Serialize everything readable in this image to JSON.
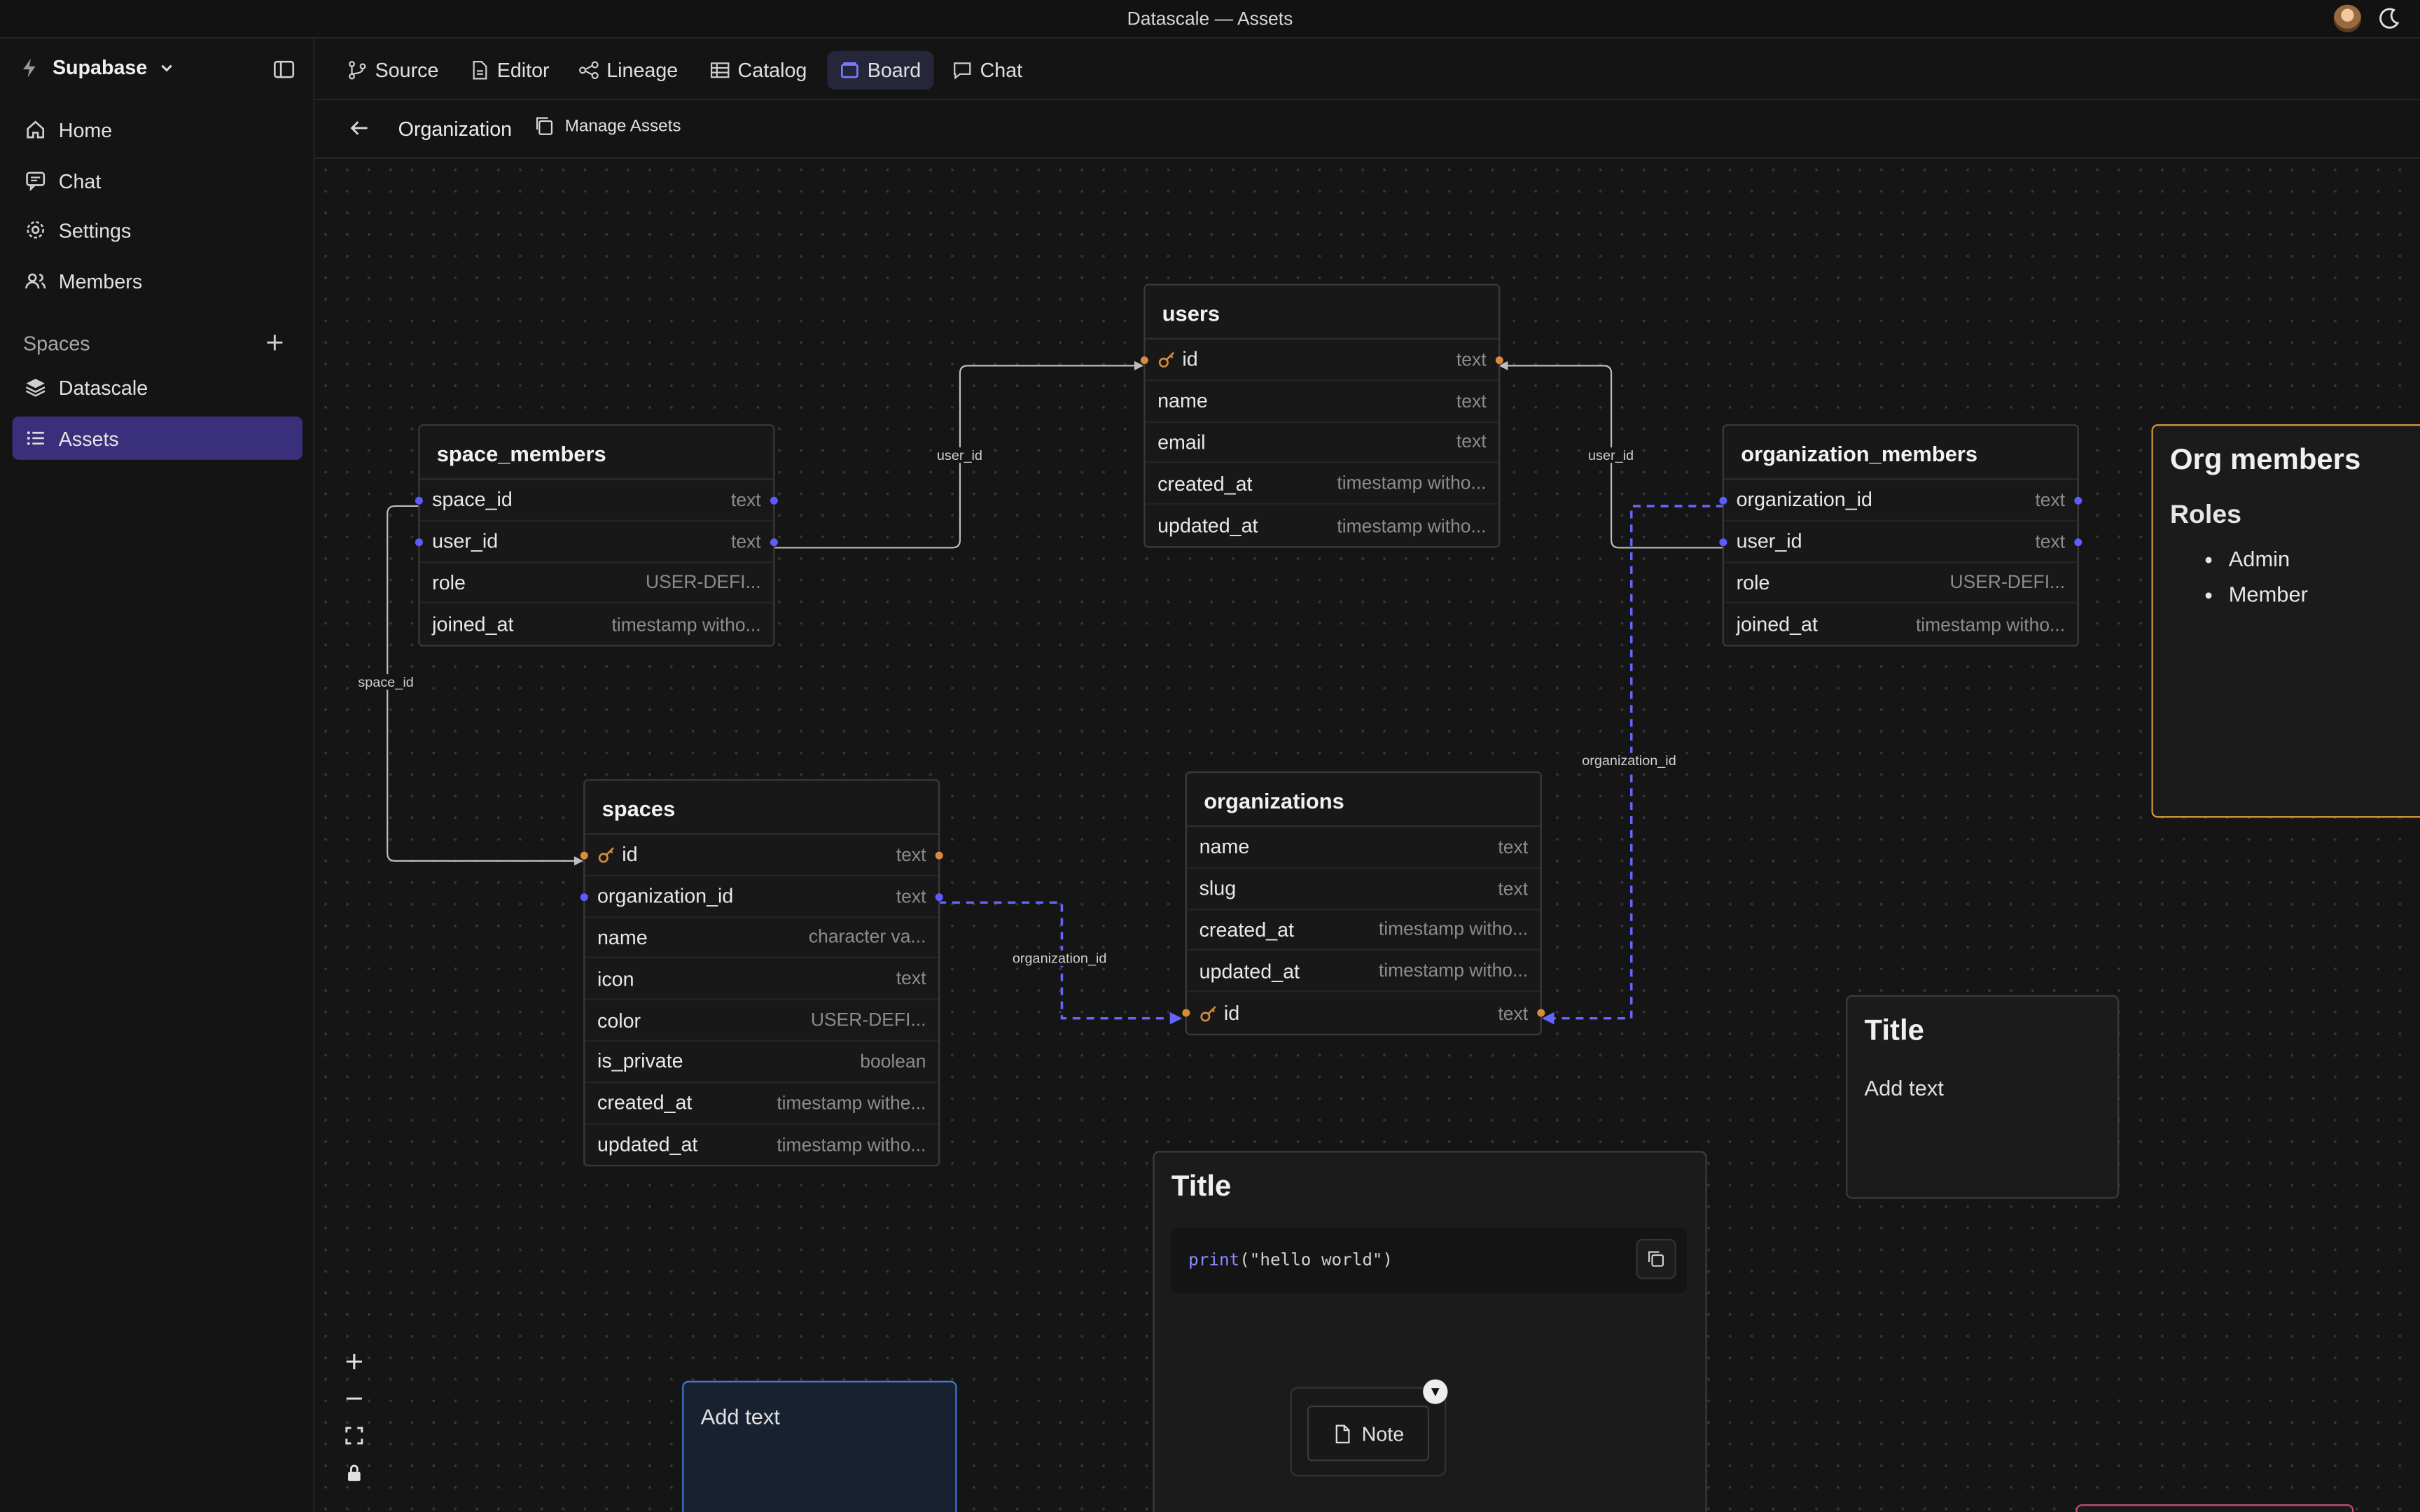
{
  "window": {
    "title": "Datascale  —  Assets"
  },
  "sidebar": {
    "workspace": "Supabase",
    "nav": [
      {
        "label": "Home",
        "icon": "home-icon"
      },
      {
        "label": "Chat",
        "icon": "chat-icon"
      },
      {
        "label": "Settings",
        "icon": "gear-icon"
      },
      {
        "label": "Members",
        "icon": "users-icon"
      }
    ],
    "spaces_label": "Spaces",
    "spaces": [
      {
        "label": "Datascale",
        "icon": "layers-icon"
      },
      {
        "label": "Assets",
        "icon": "list-icon",
        "active": true
      }
    ]
  },
  "tabs": [
    {
      "label": "Source",
      "icon": "branch-icon"
    },
    {
      "label": "Editor",
      "icon": "file-icon"
    },
    {
      "label": "Lineage",
      "icon": "lineage-icon"
    },
    {
      "label": "Catalog",
      "icon": "table-icon"
    },
    {
      "label": "Board",
      "icon": "board-icon",
      "active": true
    },
    {
      "label": "Chat",
      "icon": "chat-icon"
    }
  ],
  "subheader": {
    "breadcrumb": "Organization",
    "manage_label": "Manage Assets"
  },
  "tables": {
    "users": {
      "title": "users",
      "columns": [
        {
          "name": "id",
          "type": "text",
          "key": true
        },
        {
          "name": "name",
          "type": "text"
        },
        {
          "name": "email",
          "type": "text"
        },
        {
          "name": "created_at",
          "type": "timestamp witho..."
        },
        {
          "name": "updated_at",
          "type": "timestamp witho..."
        }
      ]
    },
    "space_members": {
      "title": "space_members",
      "columns": [
        {
          "name": "space_id",
          "type": "text"
        },
        {
          "name": "user_id",
          "type": "text"
        },
        {
          "name": "role",
          "type": "USER-DEFI..."
        },
        {
          "name": "joined_at",
          "type": "timestamp witho..."
        }
      ]
    },
    "organization_members": {
      "title": "organization_members",
      "columns": [
        {
          "name": "organization_id",
          "type": "text"
        },
        {
          "name": "user_id",
          "type": "text"
        },
        {
          "name": "role",
          "type": "USER-DEFI..."
        },
        {
          "name": "joined_at",
          "type": "timestamp witho..."
        }
      ]
    },
    "spaces": {
      "title": "spaces",
      "columns": [
        {
          "name": "id",
          "type": "text",
          "key": true
        },
        {
          "name": "organization_id",
          "type": "text"
        },
        {
          "name": "name",
          "type": "character va..."
        },
        {
          "name": "icon",
          "type": "text"
        },
        {
          "name": "color",
          "type": "USER-DEFI..."
        },
        {
          "name": "is_private",
          "type": "boolean"
        },
        {
          "name": "created_at",
          "type": "timestamp withe..."
        },
        {
          "name": "updated_at",
          "type": "timestamp witho..."
        }
      ]
    },
    "organizations": {
      "title": "organizations",
      "columns": [
        {
          "name": "name",
          "type": "text"
        },
        {
          "name": "slug",
          "type": "text"
        },
        {
          "name": "created_at",
          "type": "timestamp witho..."
        },
        {
          "name": "updated_at",
          "type": "timestamp witho..."
        },
        {
          "name": "id",
          "type": "text",
          "key": true
        }
      ]
    }
  },
  "edge_labels": {
    "user_id_1": "user_id",
    "user_id_2": "user_id",
    "space_id": "space_id",
    "organization_id_1": "organization_id",
    "organization_id_2": "organization_id"
  },
  "notes": {
    "org": {
      "title": "Org members",
      "subtitle": "Roles",
      "items": [
        "Admin",
        "Member"
      ]
    },
    "title_card": {
      "title": "Title",
      "body": "Add text"
    },
    "code_card": {
      "title": "Title",
      "code_fn": "print",
      "code_args": "(\"hello world\")",
      "embed_label": "Note",
      "dropdown": "▼"
    },
    "text_card": {
      "body": "Add text"
    }
  },
  "colors": {
    "accent": "#5b5bff",
    "active_nav": "#3a2f7a",
    "key": "#d98a3a",
    "org_note_border": "#d9983c"
  }
}
